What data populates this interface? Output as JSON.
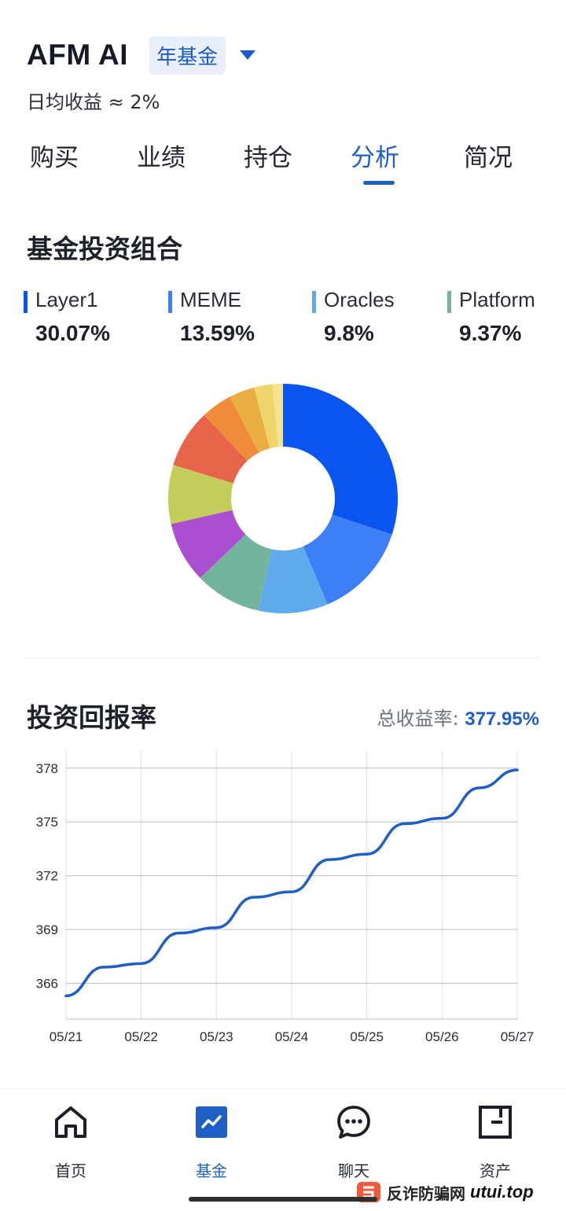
{
  "header": {
    "app_title": "AFM AI",
    "fund_tag": "年基金",
    "subtitle": "日均收益 ≈ 2%"
  },
  "tabs": [
    {
      "label": "购买",
      "active": false
    },
    {
      "label": "业绩",
      "active": false
    },
    {
      "label": "持仓",
      "active": false
    },
    {
      "label": "分析",
      "active": true
    },
    {
      "label": "简况",
      "active": false
    }
  ],
  "portfolio": {
    "title": "基金投资组合",
    "legend": [
      {
        "label": "Layer1",
        "value": "30.07%",
        "color": "#0a55ef"
      },
      {
        "label": "MEME",
        "value": "13.59%",
        "color": "#3f7ff5"
      },
      {
        "label": "Oracles",
        "value": "9.8%",
        "color": "#61aaed"
      },
      {
        "label": "Platform",
        "value": "9.37%",
        "color": "#74b39c"
      }
    ]
  },
  "returns": {
    "title": "投资回报率",
    "total_label": "总收益率: ",
    "total_value": "377.95%"
  },
  "chart_data": [
    {
      "type": "pie",
      "donut": true,
      "segments": [
        {
          "name": "Layer1",
          "value": 30.07,
          "color": "#0a55ef"
        },
        {
          "name": "MEME",
          "value": 13.59,
          "color": "#3f7ff5"
        },
        {
          "name": "Oracles",
          "value": 9.8,
          "color": "#61aaed"
        },
        {
          "name": "Platform",
          "value": 9.37,
          "color": "#74b39c"
        },
        {
          "value": 8.6,
          "color": "#a94fcf"
        },
        {
          "value": 8.3,
          "color": "#c4cc5c"
        },
        {
          "value": 8.2,
          "color": "#e5644a"
        },
        {
          "value": 4.4,
          "color": "#ee8c3c"
        },
        {
          "value": 3.6,
          "color": "#e9ad42"
        },
        {
          "value": 2.6,
          "color": "#eed46a"
        },
        {
          "value": 1.46,
          "color": "#f3e28e"
        }
      ]
    },
    {
      "type": "line",
      "x": [
        "05/21",
        "05/22",
        "05/23",
        "05/24",
        "05/25",
        "05/26",
        "05/27"
      ],
      "x_fine": [
        0,
        0.5,
        1,
        1.5,
        2,
        2.5,
        3,
        3.5,
        4,
        4.5,
        5,
        5.5,
        6
      ],
      "y": [
        365.3,
        366.9,
        367.1,
        368.8,
        369.1,
        370.8,
        371.1,
        372.9,
        373.2,
        374.9,
        375.2,
        376.9,
        377.9
      ],
      "yticks": [
        366,
        369,
        372,
        375,
        378
      ],
      "ylim": [
        364,
        379
      ],
      "grid": true,
      "color": "#1f5fc3"
    }
  ],
  "bottom_nav": [
    {
      "label": "首页",
      "icon": "home-icon",
      "active": false
    },
    {
      "label": "基金",
      "icon": "fund-chart-icon",
      "active": true
    },
    {
      "label": "聊天",
      "icon": "chat-icon",
      "active": false
    },
    {
      "label": "资产",
      "icon": "wallet-icon",
      "active": false
    }
  ],
  "watermark": {
    "text": "反诈防骗网",
    "site": "utui.top"
  }
}
